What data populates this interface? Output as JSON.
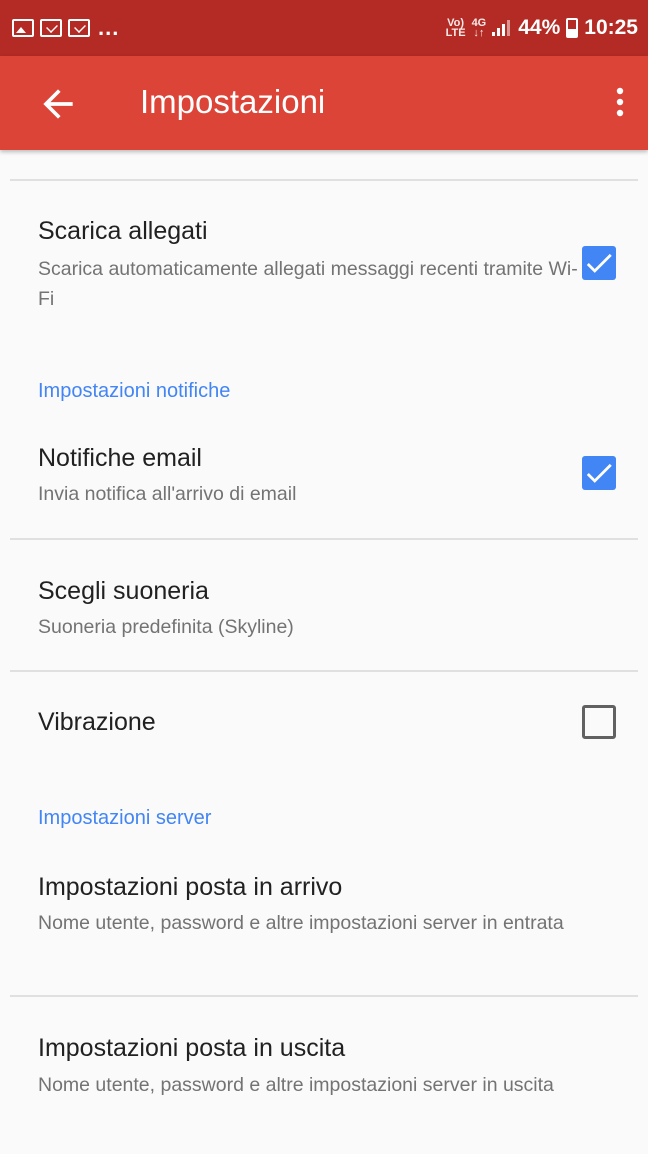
{
  "status_bar": {
    "more_indicator": "...",
    "network_label_top": "Vo)",
    "network_label_bottom": "LTE",
    "data_label_top": "4G",
    "data_label_bottom": "↓↑",
    "battery_percent": "44%",
    "time": "10:25",
    "icons": [
      "image-icon",
      "mail-icon",
      "mail-icon",
      "signal-icon",
      "battery-icon"
    ]
  },
  "app_bar": {
    "title": "Impostazioni",
    "back_icon": "arrow-back-icon",
    "overflow_icon": "more-vert-icon",
    "color": "#db4437"
  },
  "accent_color": "#4285f4",
  "settings": {
    "download_attachments": {
      "title": "Scarica allegati",
      "summary": "Scarica automaticamente allegati messaggi recenti tramite Wi-Fi",
      "checked": true
    },
    "notifications_header": "Impostazioni notifiche",
    "email_notifications": {
      "title": "Notifiche email",
      "summary": "Invia notifica all'arrivo di email",
      "checked": true
    },
    "ringtone": {
      "title": "Scegli suoneria",
      "summary": "Suoneria predefinita (Skyline)"
    },
    "vibration": {
      "title": "Vibrazione",
      "checked": false
    },
    "server_header": "Impostazioni server",
    "incoming": {
      "title": "Impostazioni posta in arrivo",
      "summary": "Nome utente, password e altre impostazioni server in entrata"
    },
    "outgoing": {
      "title": "Impostazioni posta in uscita",
      "summary": "Nome utente, password e altre impostazioni server in uscita"
    }
  }
}
